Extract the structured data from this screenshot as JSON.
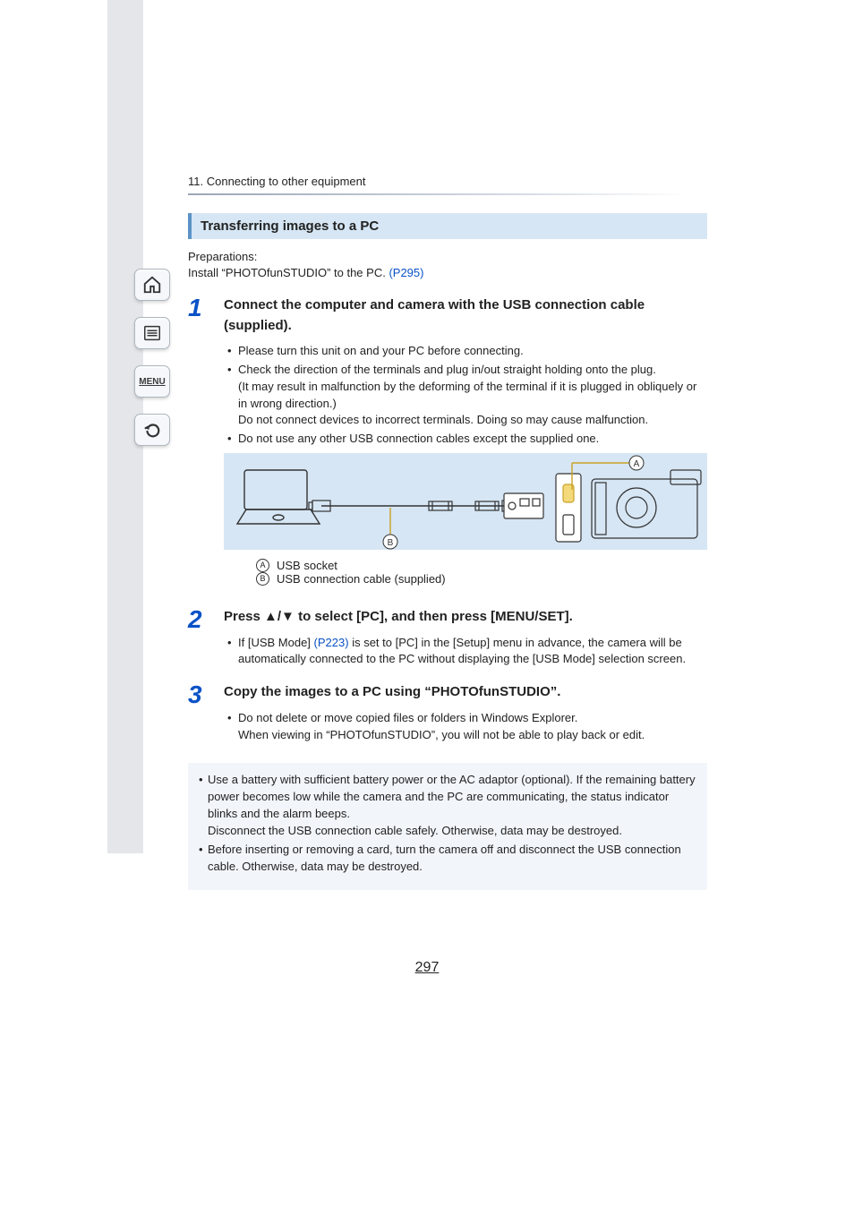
{
  "breadcrumb": "11. Connecting to other equipment",
  "section_heading": "Transferring images to a PC",
  "prep": {
    "label": "Preparations:",
    "line_prefix": "Install “PHOTOfunSTUDIO” to the PC. ",
    "link": "(P295)"
  },
  "steps": [
    {
      "num": "1",
      "title": "Connect the computer and camera with the USB connection cable (supplied).",
      "bullets": [
        {
          "text": "Please turn this unit on and your PC before connecting."
        },
        {
          "text": "Check the direction of the terminals and plug in/out straight holding onto the plug.",
          "cont": [
            "(It may result in malfunction by the deforming of the terminal if it is plugged in obliquely or in wrong direction.)",
            "Do not connect devices to incorrect terminals. Doing so may cause malfunction."
          ]
        },
        {
          "text": "Do not use any other USB connection cables except the supplied one."
        }
      ],
      "legend": [
        {
          "mark": "A",
          "text": "USB socket"
        },
        {
          "mark": "B",
          "text": "USB connection cable (supplied)"
        }
      ]
    },
    {
      "num": "2",
      "title_prefix": "Press ",
      "title_arrows": "▲/▼",
      "title_suffix": " to select [PC], and then press [MENU/SET].",
      "bullets": [
        {
          "text_prefix": "If [USB Mode] ",
          "link": "(P223)",
          "text_suffix": " is set to [PC] in the [Setup] menu in advance, the camera will be automatically connected to the PC without displaying the [USB Mode] selection screen."
        }
      ]
    },
    {
      "num": "3",
      "title": "Copy the images to a PC using “PHOTOfunSTUDIO”.",
      "bullets": [
        {
          "text": "Do not delete or move copied files or folders in Windows Explorer.",
          "cont": [
            "When viewing in “PHOTOfunSTUDIO”, you will not be able to play back or edit."
          ]
        }
      ]
    }
  ],
  "bottom_notes": [
    {
      "text": "Use a battery with sufficient battery power or the AC adaptor (optional). If the remaining battery power becomes low while the camera and the PC are communicating, the status indicator blinks and the alarm beeps.",
      "sub": [
        "Disconnect the USB connection cable safely. Otherwise, data may be destroyed."
      ]
    },
    {
      "text": "Before inserting or removing a card, turn the camera off and disconnect the USB connection cable. Otherwise, data may be destroyed."
    }
  ],
  "page_number": "297",
  "sidebar": {
    "home": "home-icon",
    "toc": "toc-icon",
    "menu_label": "MENU",
    "back": "back-icon"
  },
  "diagram": {
    "markerA": "A",
    "markerB": "B"
  }
}
